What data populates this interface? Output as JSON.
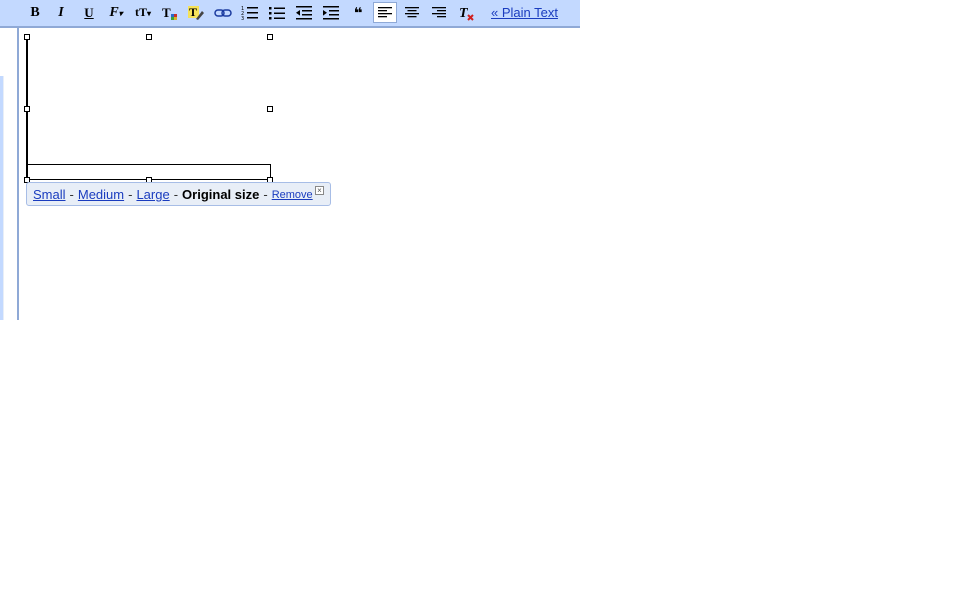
{
  "toolbar": {
    "buttons": [
      {
        "name": "bold-button",
        "icon": "bold-icon",
        "glyph": "B"
      },
      {
        "name": "italic-button",
        "icon": "italic-icon",
        "glyph": "I"
      },
      {
        "name": "underline-button",
        "icon": "underline-icon",
        "glyph": "U"
      },
      {
        "name": "font-button",
        "icon": "font-icon",
        "glyph": "𝓕"
      },
      {
        "name": "text-size-button",
        "icon": "text-size-icon",
        "glyph": "tT"
      },
      {
        "name": "text-color-button",
        "icon": "text-color-icon",
        "glyph": "T"
      },
      {
        "name": "highlight-color-button",
        "icon": "highlight-icon",
        "glyph": "T"
      },
      {
        "name": "link-button",
        "icon": "link-icon"
      },
      {
        "name": "numbered-list-button",
        "icon": "numbered-list-icon"
      },
      {
        "name": "bulleted-list-button",
        "icon": "bulleted-list-icon"
      },
      {
        "name": "indent-less-button",
        "icon": "indent-less-icon"
      },
      {
        "name": "indent-more-button",
        "icon": "indent-more-icon"
      },
      {
        "name": "quote-button",
        "icon": "quote-icon",
        "glyph": "❝"
      },
      {
        "name": "align-left-button",
        "icon": "align-left-icon",
        "active": true
      },
      {
        "name": "align-center-button",
        "icon": "align-center-icon"
      },
      {
        "name": "align-right-button",
        "icon": "align-right-icon"
      },
      {
        "name": "remove-formatting-button",
        "icon": "remove-formatting-icon",
        "glyph": "T"
      }
    ],
    "plain_text_label": "« Plain Text"
  },
  "image_bubble": {
    "small": "Small",
    "medium": "Medium",
    "large": "Large",
    "original": "Original size",
    "remove": "Remove",
    "separator": "-"
  },
  "colors": {
    "toolbar_bg": "#c3d9ff",
    "link": "#1a3cbf",
    "bubble_bg": "#e8eef7"
  }
}
